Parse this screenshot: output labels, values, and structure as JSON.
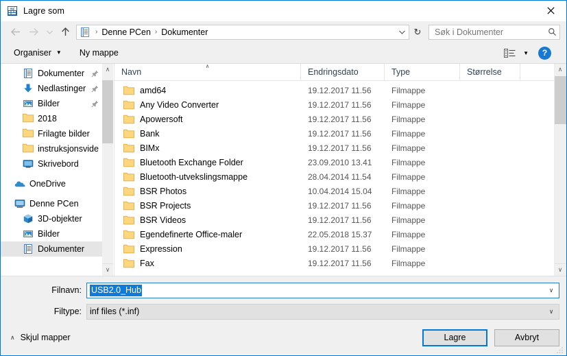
{
  "window": {
    "title": "Lagre som",
    "title_icon": "inf-file-icon",
    "close_label": "✕"
  },
  "nav": {
    "back_icon": "back-arrow-icon",
    "forward_icon": "forward-arrow-icon",
    "history_icon": "chevron-down-icon",
    "up_icon": "up-arrow-icon",
    "address_icon": "documents-folder-icon",
    "breadcrumbs": [
      "Denne PCen",
      "Dokumenter"
    ],
    "separator": "›",
    "address_dropdown_icon": "chevron-down-icon",
    "refresh_icon": "↻",
    "search_placeholder": "Søk i Dokumenter",
    "search_icon": "magnifier-icon"
  },
  "command_bar": {
    "organize_label": "Organiser",
    "organize_caret": "▼",
    "new_folder_label": "Ny mappe",
    "view_icon": "list-view-icon",
    "view_caret": "▼",
    "help_label": "?"
  },
  "sidebar": {
    "scroll_up_icon": "∧",
    "scroll_down_icon": "∨",
    "items": [
      {
        "label": "Dokumenter",
        "icon": "documents-icon",
        "indent": 1,
        "pinned": true,
        "selected": false,
        "gap": false
      },
      {
        "label": "Nedlastinger",
        "icon": "downloads-icon",
        "indent": 1,
        "pinned": true,
        "selected": false,
        "gap": false
      },
      {
        "label": "Bilder",
        "icon": "pictures-icon",
        "indent": 1,
        "pinned": true,
        "selected": false,
        "gap": false
      },
      {
        "label": "2018",
        "icon": "folder-icon",
        "indent": 1,
        "pinned": false,
        "selected": false,
        "gap": false
      },
      {
        "label": "Frilagte bilder",
        "icon": "folder-icon",
        "indent": 1,
        "pinned": false,
        "selected": false,
        "gap": false
      },
      {
        "label": "instruksjonsvide",
        "icon": "folder-icon",
        "indent": 1,
        "pinned": false,
        "selected": false,
        "gap": false
      },
      {
        "label": "Skrivebord",
        "icon": "desktop-icon",
        "indent": 1,
        "pinned": false,
        "selected": false,
        "gap": false
      },
      {
        "label": "OneDrive",
        "icon": "onedrive-icon",
        "indent": 0,
        "pinned": false,
        "selected": false,
        "gap": true
      },
      {
        "label": "Denne PCen",
        "icon": "this-pc-icon",
        "indent": 0,
        "pinned": false,
        "selected": false,
        "gap": true
      },
      {
        "label": "3D-objekter",
        "icon": "3d-objects-icon",
        "indent": 1,
        "pinned": false,
        "selected": false,
        "gap": false
      },
      {
        "label": "Bilder",
        "icon": "pictures-icon",
        "indent": 1,
        "pinned": false,
        "selected": false,
        "gap": false
      },
      {
        "label": "Dokumenter",
        "icon": "documents-icon",
        "indent": 1,
        "pinned": false,
        "selected": true,
        "gap": false
      }
    ]
  },
  "file_list": {
    "columns": [
      {
        "label": "Navn",
        "sorted": true
      },
      {
        "label": "Endringsdato",
        "sorted": false
      },
      {
        "label": "Type",
        "sorted": false
      },
      {
        "label": "Størrelse",
        "sorted": false
      }
    ],
    "sort_indicator": "∧",
    "scroll_up_icon": "∧",
    "scroll_down_icon": "∨",
    "rows": [
      {
        "name": "amd64",
        "date": "19.12.2017 11.56",
        "type": "Filmappe",
        "size": ""
      },
      {
        "name": "Any Video Converter",
        "date": "19.12.2017 11.56",
        "type": "Filmappe",
        "size": ""
      },
      {
        "name": "Apowersoft",
        "date": "19.12.2017 11.56",
        "type": "Filmappe",
        "size": ""
      },
      {
        "name": "Bank",
        "date": "19.12.2017 11.56",
        "type": "Filmappe",
        "size": ""
      },
      {
        "name": "BIMx",
        "date": "19.12.2017 11.56",
        "type": "Filmappe",
        "size": ""
      },
      {
        "name": "Bluetooth Exchange Folder",
        "date": "23.09.2010 13.41",
        "type": "Filmappe",
        "size": ""
      },
      {
        "name": "Bluetooth-utvekslingsmappe",
        "date": "28.04.2014 11.54",
        "type": "Filmappe",
        "size": ""
      },
      {
        "name": "BSR Photos",
        "date": "10.04.2014 15.04",
        "type": "Filmappe",
        "size": ""
      },
      {
        "name": "BSR Projects",
        "date": "19.12.2017 11.56",
        "type": "Filmappe",
        "size": ""
      },
      {
        "name": "BSR Videos",
        "date": "19.12.2017 11.56",
        "type": "Filmappe",
        "size": ""
      },
      {
        "name": "Egendefinerte Office-maler",
        "date": "22.05.2018 15.37",
        "type": "Filmappe",
        "size": ""
      },
      {
        "name": "Expression",
        "date": "19.12.2017 11.56",
        "type": "Filmappe",
        "size": ""
      },
      {
        "name": "Fax",
        "date": "19.12.2017 11.56",
        "type": "Filmappe",
        "size": ""
      }
    ]
  },
  "form": {
    "filename_label": "Filnavn:",
    "filename_value": "USB2.0_Hub",
    "filename_caret": "∨",
    "filetype_label": "Filtype:",
    "filetype_value": "inf files (*.inf)",
    "filetype_caret": "∨"
  },
  "footer": {
    "hide_folders_label": "Skjul mapper",
    "hide_folders_caret": "∧",
    "save_label": "Lagre",
    "cancel_label": "Avbryt"
  },
  "colors": {
    "accent": "#0078d7",
    "selection": "#0e7ada",
    "folder": "#fcd77f",
    "chrome": "#f0f0f0"
  }
}
